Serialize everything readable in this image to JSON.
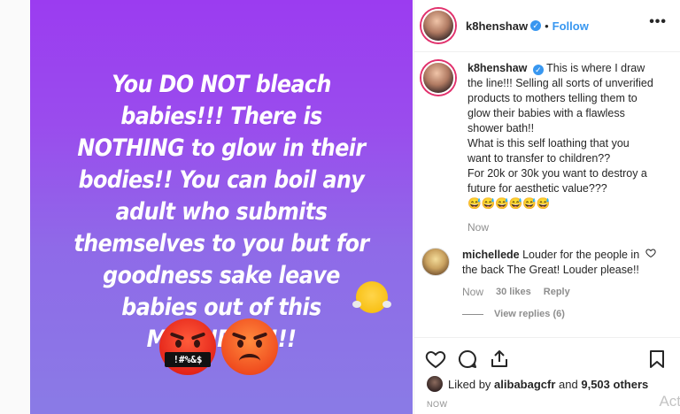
{
  "image": {
    "caption_text": "You DO NOT bleach babies!!! There is NOTHING to glow in their bodies!! You can boil any adult who submits themselves to you but for goodness sake leave babies out of this MADNESS!!!!",
    "cursing_face_text": "!#%&$"
  },
  "header": {
    "username": "k8henshaw",
    "verified_mark": "✓",
    "separator": "•",
    "follow_label": "Follow",
    "more_label": "•••"
  },
  "caption": {
    "username": "k8henshaw",
    "verified_mark": "✓",
    "text": "This is where I draw the line!!! Selling all sorts of unverified products to mothers telling them to glow their babies with a flawless shower bath!!\nWhat is this self loathing that you want to transfer to children??\nFor 20k or 30k you want to destroy a future for aesthetic value???\n😅😅😅😅😅😅",
    "time": "Now"
  },
  "comment": {
    "username": "michellede",
    "text": "Louder for the people in the back The Great! Louder please!!",
    "time": "Now",
    "likes": "30 likes",
    "reply_label": "Reply",
    "view_replies": "View replies (6)"
  },
  "likes_bar": {
    "prefix": "Liked by",
    "liker": "alibabagcfr",
    "and": "and",
    "others": "9,503 others"
  },
  "timestamp": "NOW",
  "watermark": "Act",
  "colors": {
    "link_blue": "#3897f0",
    "gradient_top": "#9b3cf0",
    "gradient_bottom": "#8a7be6",
    "secondary_text": "#8e8e8e"
  }
}
